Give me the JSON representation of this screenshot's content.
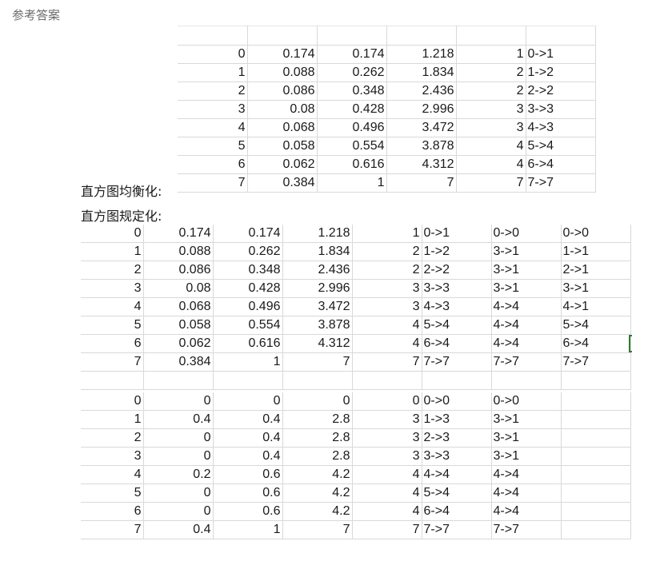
{
  "heading": "参考答案",
  "labels": {
    "equalization": "直方图均衡化:",
    "specification": "直方图规定化:"
  },
  "table_equalization": {
    "rows": [
      [
        "0",
        "0.174",
        "0.174",
        "1.218",
        "1",
        "0->1"
      ],
      [
        "1",
        "0.088",
        "0.262",
        "1.834",
        "2",
        "1->2"
      ],
      [
        "2",
        "0.086",
        "0.348",
        "2.436",
        "2",
        "2->2"
      ],
      [
        "3",
        "0.08",
        "0.428",
        "2.996",
        "3",
        "3->3"
      ],
      [
        "4",
        "0.068",
        "0.496",
        "3.472",
        "3",
        "4->3"
      ],
      [
        "5",
        "0.058",
        "0.554",
        "3.878",
        "4",
        "5->4"
      ],
      [
        "6",
        "0.062",
        "0.616",
        "4.312",
        "4",
        "6->4"
      ],
      [
        "7",
        "0.384",
        "1",
        "7",
        "7",
        "7->7"
      ]
    ]
  },
  "table_spec_source": {
    "rows": [
      [
        "0",
        "0.174",
        "0.174",
        "1.218",
        "1",
        "0->1",
        "0->0",
        "0->0"
      ],
      [
        "1",
        "0.088",
        "0.262",
        "1.834",
        "2",
        "1->2",
        "3->1",
        "1->1"
      ],
      [
        "2",
        "0.086",
        "0.348",
        "2.436",
        "2",
        "2->2",
        "3->1",
        "2->1"
      ],
      [
        "3",
        "0.08",
        "0.428",
        "2.996",
        "3",
        "3->3",
        "3->1",
        "3->1"
      ],
      [
        "4",
        "0.068",
        "0.496",
        "3.472",
        "3",
        "4->3",
        "4->4",
        "4->1"
      ],
      [
        "5",
        "0.058",
        "0.554",
        "3.878",
        "4",
        "5->4",
        "4->4",
        "5->4"
      ],
      [
        "6",
        "0.062",
        "0.616",
        "4.312",
        "4",
        "6->4",
        "4->4",
        "6->4"
      ],
      [
        "7",
        "0.384",
        "1",
        "7",
        "7",
        "7->7",
        "7->7",
        "7->7"
      ]
    ]
  },
  "table_spec_target": {
    "rows": [
      [
        "0",
        "0",
        "0",
        "0",
        "0",
        "0->0",
        "0->0",
        ""
      ],
      [
        "1",
        "0.4",
        "0.4",
        "2.8",
        "3",
        "1->3",
        "3->1",
        ""
      ],
      [
        "2",
        "0",
        "0.4",
        "2.8",
        "3",
        "2->3",
        "3->1",
        ""
      ],
      [
        "3",
        "0",
        "0.4",
        "2.8",
        "3",
        "3->3",
        "3->1",
        ""
      ],
      [
        "4",
        "0.2",
        "0.6",
        "4.2",
        "4",
        "4->4",
        "4->4",
        ""
      ],
      [
        "5",
        "0",
        "0.6",
        "4.2",
        "4",
        "5->4",
        "4->4",
        ""
      ],
      [
        "6",
        "0",
        "0.6",
        "4.2",
        "4",
        "6->4",
        "4->4",
        ""
      ],
      [
        "7",
        "0.4",
        "1",
        "7",
        "7",
        "7->7",
        "7->7",
        ""
      ]
    ]
  }
}
